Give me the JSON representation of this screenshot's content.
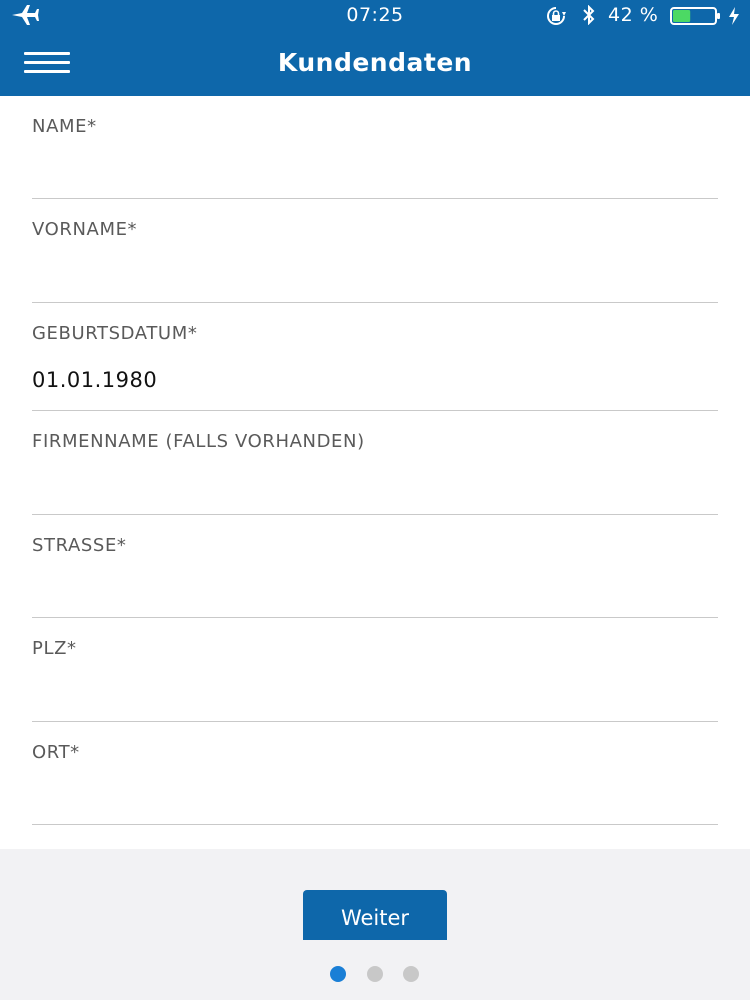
{
  "status_bar": {
    "time": "07:25",
    "battery_percent": "42 %",
    "battery_level": 0.42,
    "icons": [
      "airplane-icon",
      "rotation-lock-icon",
      "bluetooth-icon",
      "battery-icon",
      "charging-bolt-icon"
    ]
  },
  "nav": {
    "title": "Kundendaten",
    "menu_icon": "hamburger-menu-icon"
  },
  "form": {
    "fields": [
      {
        "label": "NAME*",
        "value": ""
      },
      {
        "label": "VORNAME*",
        "value": ""
      },
      {
        "label": "GEBURTSDATUM*",
        "value": "01.01.1980"
      },
      {
        "label": "FIRMENNAME (FALLS VORHANDEN)",
        "value": ""
      },
      {
        "label": "STRASSE*",
        "value": ""
      },
      {
        "label": "PLZ*",
        "value": ""
      },
      {
        "label": "ORT*",
        "value": ""
      }
    ]
  },
  "footer": {
    "next_label": "Weiter",
    "pages": 3,
    "active_page": 1
  },
  "colors": {
    "brand": "#0e67aa",
    "active_dot": "#1a7fd6",
    "battery_fill": "#4cd964"
  }
}
